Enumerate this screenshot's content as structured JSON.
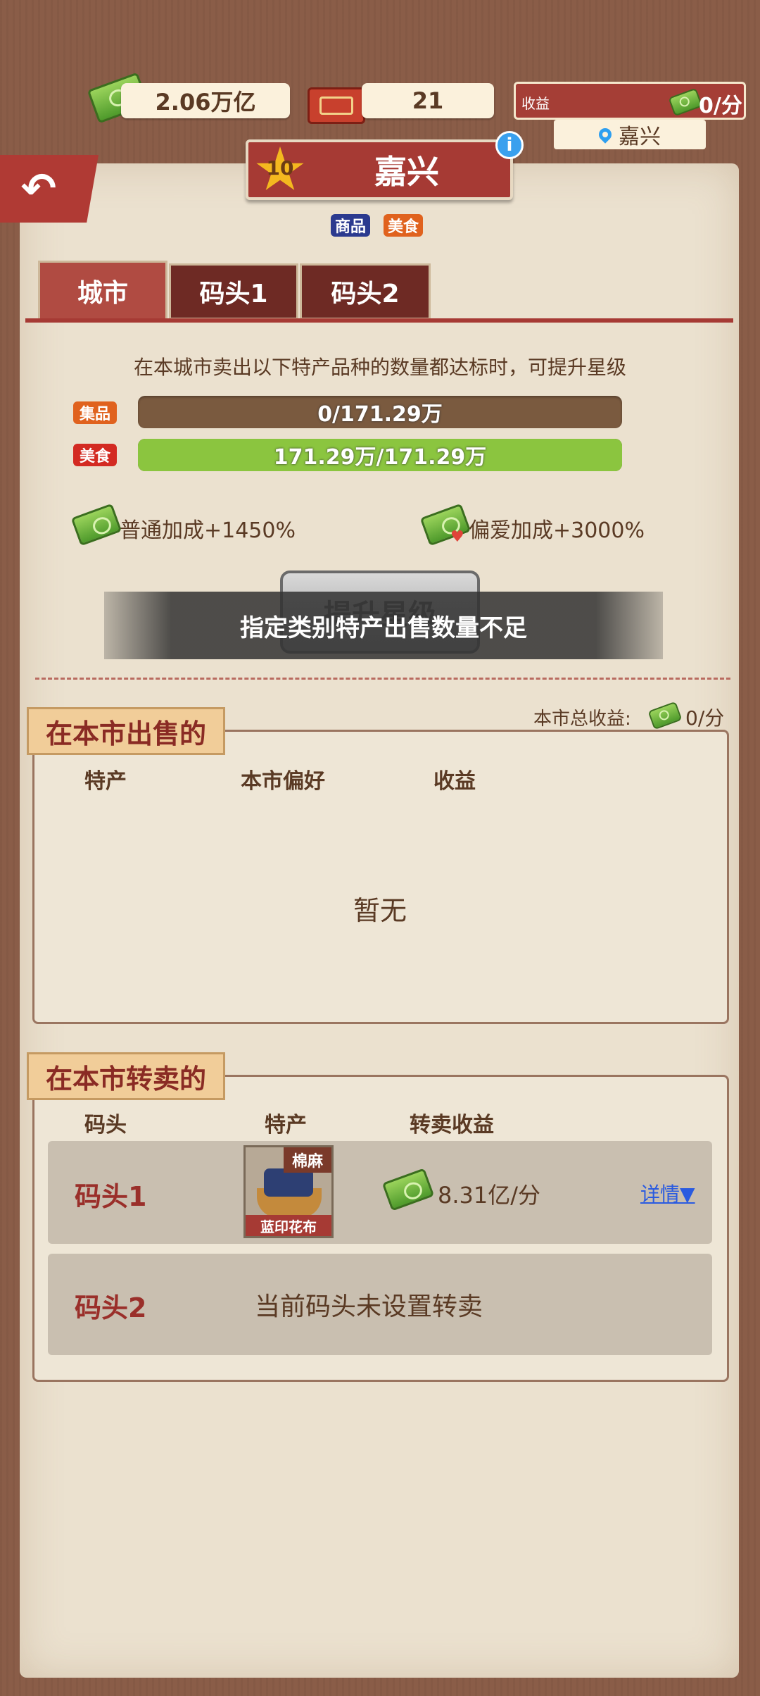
{
  "hud": {
    "money": "2.06万亿",
    "tickets": "21",
    "income_label": "收益",
    "income_value": "0/分",
    "location": "嘉兴"
  },
  "header": {
    "city_level": "10",
    "city_name": "嘉兴",
    "tags": [
      "商品",
      "美食"
    ]
  },
  "tabs": [
    "城市",
    "码头1",
    "码头2"
  ],
  "upgrade": {
    "requirement_text": "在本城市卖出以下特产品种的数量都达标时，可提升星级",
    "categories": [
      {
        "label": "集品",
        "progress_text": "0/171.29万",
        "progress": 0
      },
      {
        "label": "美食",
        "progress_text": "171.29万/171.29万",
        "progress": 1
      }
    ],
    "normal_bonus": "普通加成+1450%",
    "favor_bonus": "偏爱加成+3000%",
    "button_label": "提升星级",
    "toast": "指定类别特产出售数量不足"
  },
  "sold_section": {
    "title": "在本市出售的",
    "total_label": "本市总收益:",
    "total_value": "0/分",
    "columns": [
      "特产",
      "本市偏好",
      "收益"
    ],
    "empty_text": "暂无"
  },
  "resale_section": {
    "title": "在本市转卖的",
    "columns": [
      "码头",
      "特产",
      "转卖收益"
    ],
    "rows": [
      {
        "dock": "码头1",
        "product_category": "棉麻",
        "product_name": "蓝印花布",
        "income": "8.31亿/分",
        "detail": "详情"
      },
      {
        "dock": "码头2",
        "note": "当前码头未设置转卖"
      }
    ]
  },
  "colors": {
    "accent_red": "#a63a34",
    "progress_green": "#8bc53f",
    "tag_blue": "#2b3a8f",
    "tag_orange": "#e0621e",
    "link_blue": "#2a5be0"
  }
}
